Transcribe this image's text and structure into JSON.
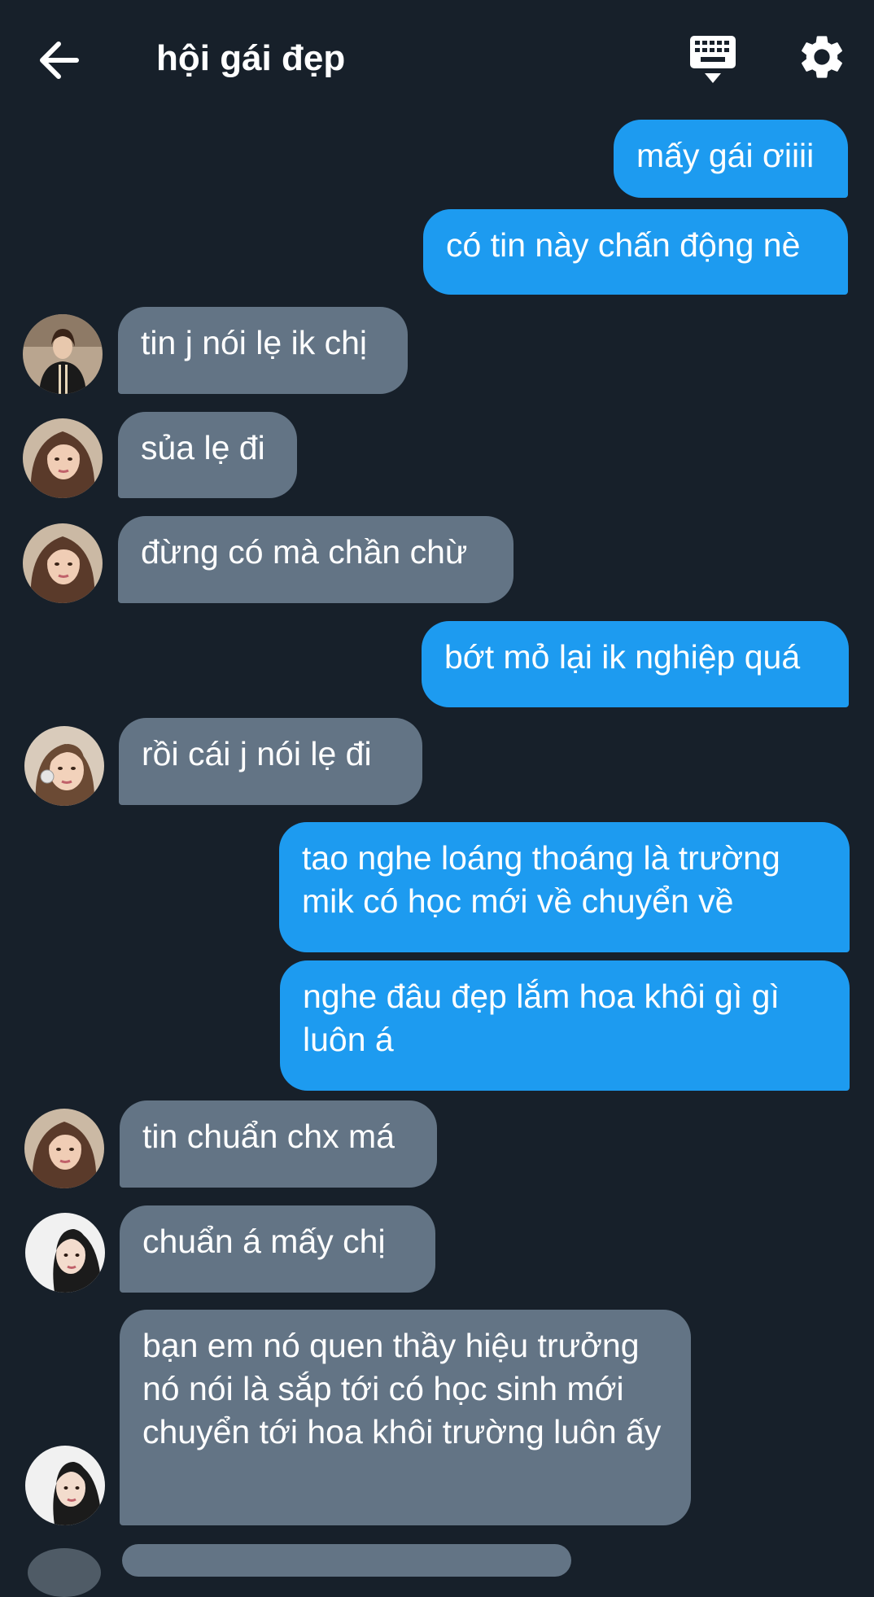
{
  "header": {
    "title": "hội gái đẹp",
    "back_icon": "arrow-left-icon",
    "keyboard_icon": "keyboard-hide-icon",
    "settings_icon": "gear-icon"
  },
  "colors": {
    "background": "#17202a",
    "sent_bubble": "#1d9bf0",
    "received_bubble": "#637485",
    "text": "#ffffff"
  },
  "messages": [
    {
      "side": "sent",
      "text": "mấy gái ơiiii"
    },
    {
      "side": "sent",
      "text": "có tin này chấn động nè"
    },
    {
      "side": "received",
      "avatar": "avatar-a",
      "text": "tin j nói lẹ ik chị"
    },
    {
      "side": "received",
      "avatar": "avatar-b",
      "text": "sủa lẹ đi"
    },
    {
      "side": "received",
      "avatar": "avatar-b",
      "text": "đừng có mà chần chừ"
    },
    {
      "side": "sent",
      "text": "bớt mỏ lại ik nghiệp quá"
    },
    {
      "side": "received",
      "avatar": "avatar-c",
      "text": "rồi cái j nói lẹ đi"
    },
    {
      "side": "sent",
      "text": "tao nghe loáng thoáng là trường mik có học mới về chuyển về"
    },
    {
      "side": "sent",
      "text": "nghe đâu đẹp lắm hoa khôi gì gì luôn á"
    },
    {
      "side": "received",
      "avatar": "avatar-b",
      "text": "tin chuẩn chx má"
    },
    {
      "side": "received",
      "avatar": "avatar-d",
      "text": "chuẩn á mấy chị"
    },
    {
      "side": "received",
      "avatar": "avatar-d",
      "text": "bạn em nó quen thầy hiệu trưởng nó nói là sắp tới có học sinh mới chuyển tới hoa khôi trường luôn ấy"
    }
  ]
}
